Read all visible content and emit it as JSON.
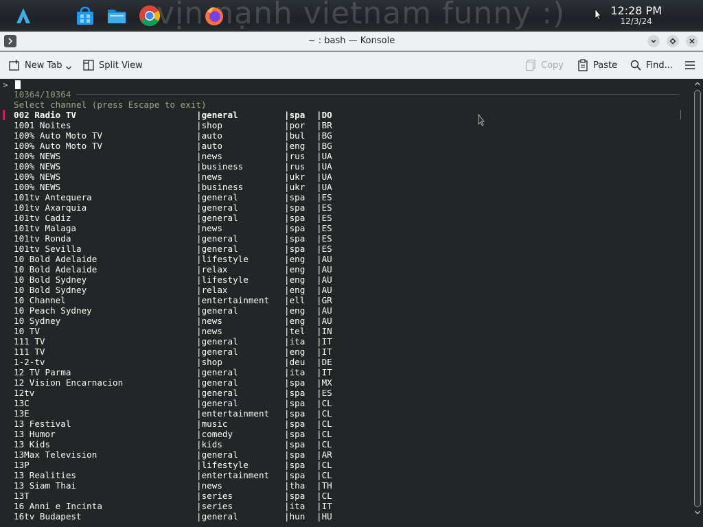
{
  "panel": {
    "wallpaper_text": "vịn nạnh vietnam funny :)",
    "clock_time": "12:28 PM",
    "clock_date": "12/3/24",
    "apps": [
      "app-launcher-icon",
      "discover-store-icon",
      "file-manager-icon",
      "chrome-icon",
      "firefox-icon"
    ]
  },
  "window": {
    "title": "~ : bash — Konsole"
  },
  "toolbar": {
    "new_tab": "New Tab",
    "split_view": "Split View",
    "copy": "Copy",
    "paste": "Paste",
    "find": "Find..."
  },
  "terminal": {
    "prompt": ">",
    "count": "10364/10364",
    "header": "Select channel (press Escape to exit)",
    "rows": [
      {
        "name": "002 Radio TV",
        "cat": "|general",
        "lang": "|spa",
        "cc": "|DO"
      },
      {
        "name": "1001 Noites",
        "cat": "|shop",
        "lang": "|por",
        "cc": "|BR"
      },
      {
        "name": "100% Auto Moto TV",
        "cat": "|auto",
        "lang": "|bul",
        "cc": "|BG"
      },
      {
        "name": "100% Auto Moto TV",
        "cat": "|auto",
        "lang": "|eng",
        "cc": "|BG"
      },
      {
        "name": "100% NEWS",
        "cat": "|news",
        "lang": "|rus",
        "cc": "|UA"
      },
      {
        "name": "100% NEWS",
        "cat": "|business",
        "lang": "|rus",
        "cc": "|UA"
      },
      {
        "name": "100% NEWS",
        "cat": "|news",
        "lang": "|ukr",
        "cc": "|UA"
      },
      {
        "name": "100% NEWS",
        "cat": "|business",
        "lang": "|ukr",
        "cc": "|UA"
      },
      {
        "name": "101tv Antequera",
        "cat": "|general",
        "lang": "|spa",
        "cc": "|ES"
      },
      {
        "name": "101tv Axarquia",
        "cat": "|general",
        "lang": "|spa",
        "cc": "|ES"
      },
      {
        "name": "101tv Cadiz",
        "cat": "|general",
        "lang": "|spa",
        "cc": "|ES"
      },
      {
        "name": "101tv Malaga",
        "cat": "|news",
        "lang": "|spa",
        "cc": "|ES"
      },
      {
        "name": "101tv Ronda",
        "cat": "|general",
        "lang": "|spa",
        "cc": "|ES"
      },
      {
        "name": "101tv Sevilla",
        "cat": "|general",
        "lang": "|spa",
        "cc": "|ES"
      },
      {
        "name": "10 Bold Adelaide",
        "cat": "|lifestyle",
        "lang": "|eng",
        "cc": "|AU"
      },
      {
        "name": "10 Bold Adelaide",
        "cat": "|relax",
        "lang": "|eng",
        "cc": "|AU"
      },
      {
        "name": "10 Bold Sydney",
        "cat": "|lifestyle",
        "lang": "|eng",
        "cc": "|AU"
      },
      {
        "name": "10 Bold Sydney",
        "cat": "|relax",
        "lang": "|eng",
        "cc": "|AU"
      },
      {
        "name": "10 Channel",
        "cat": "|entertainment",
        "lang": "|ell",
        "cc": "|GR"
      },
      {
        "name": "10 Peach Sydney",
        "cat": "|general",
        "lang": "|eng",
        "cc": "|AU"
      },
      {
        "name": "10 Sydney",
        "cat": "|news",
        "lang": "|eng",
        "cc": "|AU"
      },
      {
        "name": "10 TV",
        "cat": "|news",
        "lang": "|tel",
        "cc": "|IN"
      },
      {
        "name": "111 TV",
        "cat": "|general",
        "lang": "|ita",
        "cc": "|IT"
      },
      {
        "name": "111 TV",
        "cat": "|general",
        "lang": "|eng",
        "cc": "|IT"
      },
      {
        "name": "1-2-tv",
        "cat": "|shop",
        "lang": "|deu",
        "cc": "|DE"
      },
      {
        "name": "12 TV Parma",
        "cat": "|general",
        "lang": "|ita",
        "cc": "|IT"
      },
      {
        "name": "12 Vision Encarnacion",
        "cat": "|general",
        "lang": "|spa",
        "cc": "|MX"
      },
      {
        "name": "12tv",
        "cat": "|general",
        "lang": "|spa",
        "cc": "|ES"
      },
      {
        "name": "13C",
        "cat": "|general",
        "lang": "|spa",
        "cc": "|CL"
      },
      {
        "name": "13E",
        "cat": "|entertainment",
        "lang": "|spa",
        "cc": "|CL"
      },
      {
        "name": "13 Festival",
        "cat": "|music",
        "lang": "|spa",
        "cc": "|CL"
      },
      {
        "name": "13 Humor",
        "cat": "|comedy",
        "lang": "|spa",
        "cc": "|CL"
      },
      {
        "name": "13 Kids",
        "cat": "|kids",
        "lang": "|spa",
        "cc": "|CL"
      },
      {
        "name": "13Max Television",
        "cat": "|general",
        "lang": "|spa",
        "cc": "|AR"
      },
      {
        "name": "13P",
        "cat": "|lifestyle",
        "lang": "|spa",
        "cc": "|CL"
      },
      {
        "name": "13 Realities",
        "cat": "|entertainment",
        "lang": "|spa",
        "cc": "|CL"
      },
      {
        "name": "13 Siam Thai",
        "cat": "|news",
        "lang": "|tha",
        "cc": "|TH"
      },
      {
        "name": "13T",
        "cat": "|series",
        "lang": "|spa",
        "cc": "|CL"
      },
      {
        "name": "16 Anni e Incinta",
        "cat": "|series",
        "lang": "|ita",
        "cc": "|IT"
      },
      {
        "name": "16tv Budapest",
        "cat": "|general",
        "lang": "|hun",
        "cc": "|HU"
      }
    ]
  }
}
